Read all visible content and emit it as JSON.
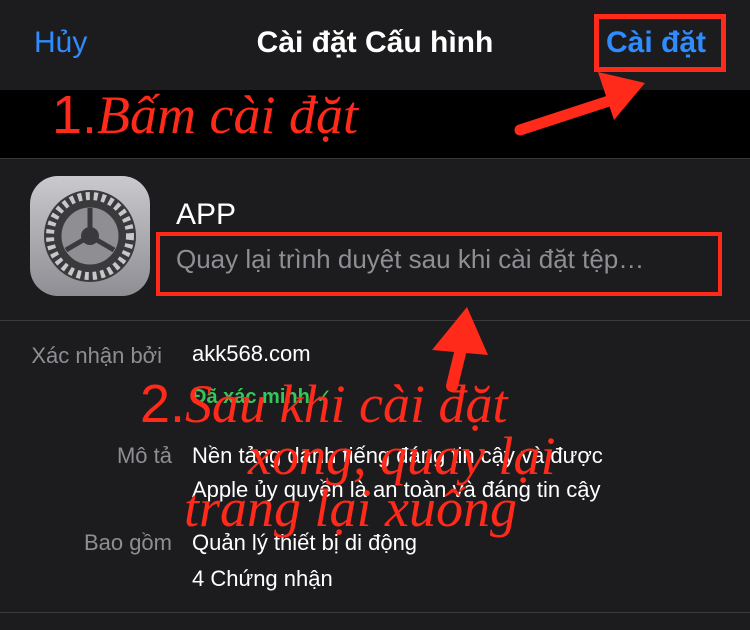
{
  "nav": {
    "cancel": "Hủy",
    "title": "Cài đặt Cấu hình",
    "install": "Cài đặt"
  },
  "annotations": {
    "step1_num": "1.",
    "step1_text": "Bấm cài đặt",
    "step2_num": "2.",
    "step2_line1": "Sau khi cài đặt",
    "step2_line2": "xong, quay lại",
    "step2_line3": "trang lại xuống",
    "color": "#ff2a1a"
  },
  "profile": {
    "name": "APP",
    "description": "Quay lại trình duyệt sau khi cài đặt tệp…",
    "icon": "settings-gear-icon"
  },
  "details": {
    "signed_label": "Xác nhận bởi",
    "signed_value": "akk568.com",
    "verified": "Đã xác minh",
    "verified_icon": "checkmark-icon",
    "desc_label": "Mô tả",
    "desc_line1": "Nền tảng danh tiếng đáng tin cậy và được",
    "desc_line2": "Apple ủy quyền là an toàn và đáng tin cậy",
    "contains_label": "Bao gồm",
    "contains_line1": "Quản lý thiết bị di động",
    "contains_line2": "4 Chứng nhận"
  },
  "colors": {
    "accent": "#2f8cff",
    "verified": "#34c759",
    "background": "#1c1c1e"
  }
}
